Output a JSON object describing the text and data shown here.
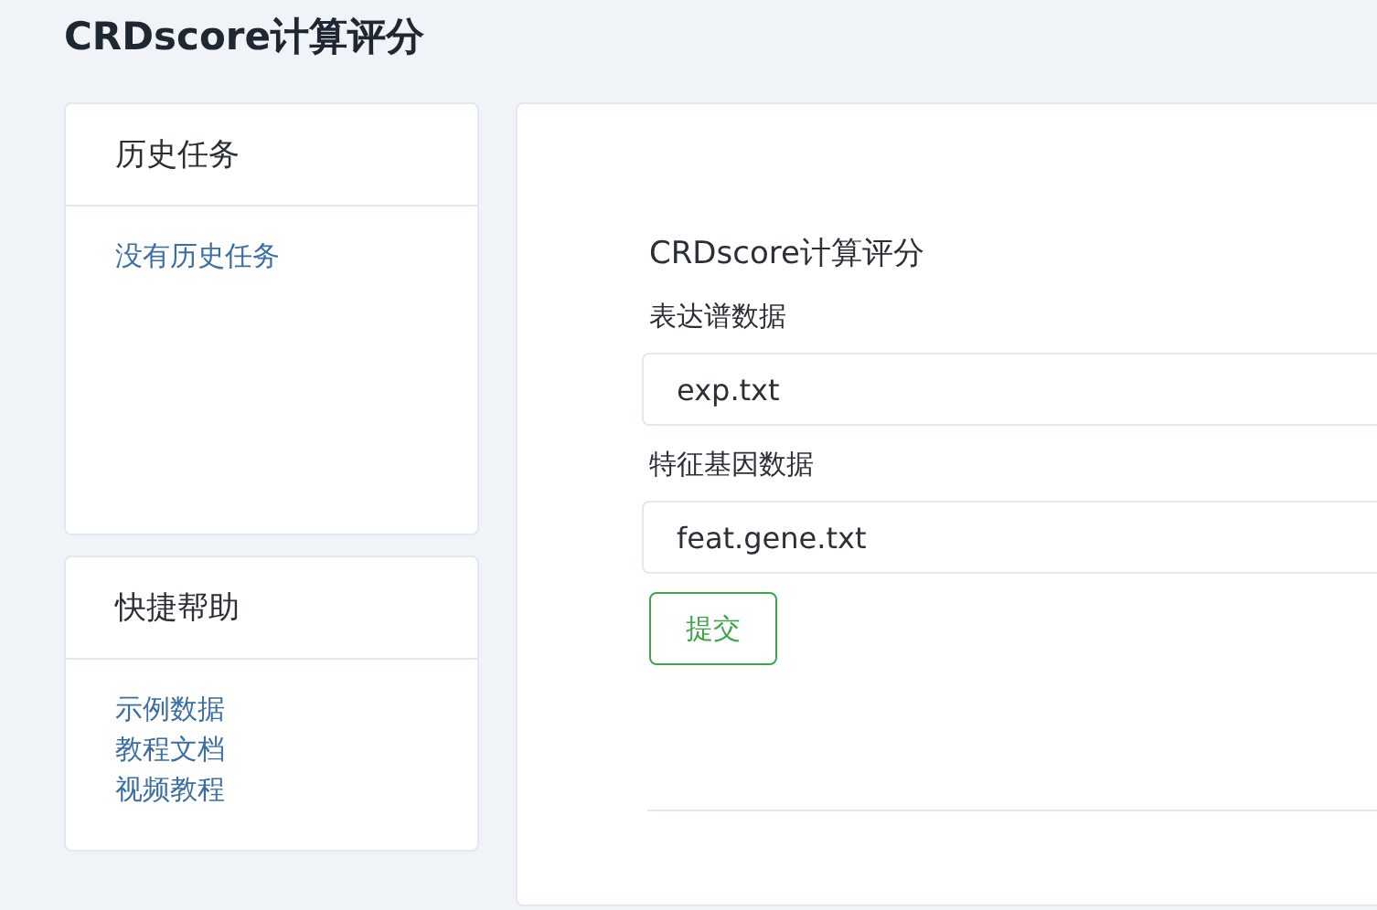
{
  "page_title": "CRDscore计算评分",
  "sidebar": [
    {
      "title": "历史任务",
      "links": [
        "没有历史任务"
      ]
    },
    {
      "title": "快捷帮助",
      "links": [
        "示例数据",
        "教程文档",
        "视频教程"
      ]
    }
  ],
  "form": {
    "title": "CRDscore计算评分",
    "fields": [
      {
        "label": "表达谱数据",
        "value": "exp.txt"
      },
      {
        "label": "特征基因数据",
        "value": "feat.gene.txt"
      }
    ],
    "submit": "提交"
  }
}
